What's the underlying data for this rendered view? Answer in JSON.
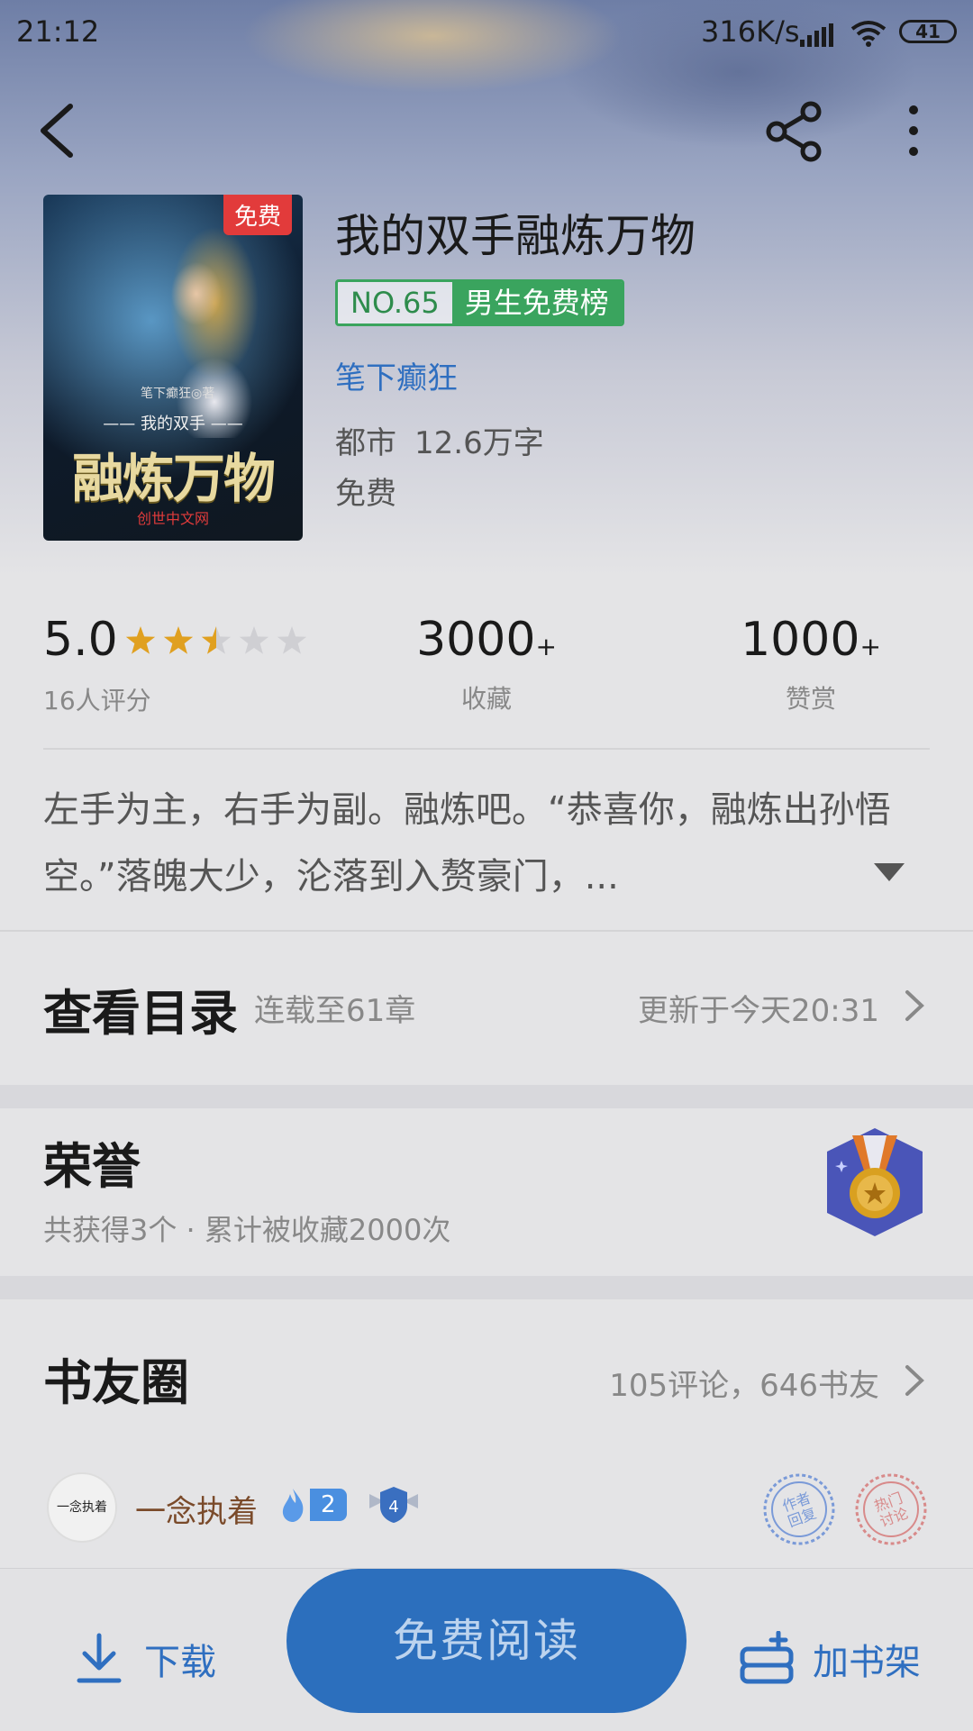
{
  "status_bar": {
    "time": "21:12",
    "net_speed": "316K/s",
    "battery": "41"
  },
  "nav": {
    "back_icon": "back-arrow-icon",
    "share_icon": "share-icon",
    "more_icon": "more-vert-icon"
  },
  "book": {
    "cover": {
      "badge": "免费",
      "author_line": "笔下癫狂◎著",
      "sub_title": "—— 我的双手 ——",
      "title_art": "融炼万物",
      "publisher": "创世中文网"
    },
    "title": "我的双手融炼万物",
    "rank_no": "NO.65",
    "rank_list": "男生免费榜",
    "author": "笔下癫狂",
    "genre": "都市",
    "word_count": "12.6万字",
    "price": "免费"
  },
  "stats": {
    "rating": "5.0",
    "rating_stars": 2.5,
    "rating_max": 5,
    "rating_count": "16人评分",
    "favorites": "3000",
    "favorites_label": "收藏",
    "rewards": "1000",
    "rewards_label": "赞赏",
    "plus": "+"
  },
  "intro": {
    "text": "左手为主，右手为副。融炼吧。“恭喜你，融炼出孙悟空。”落魄大少，沦落到入赘豪门，..."
  },
  "catalog": {
    "title": "查看目录",
    "status": "连载至61章",
    "update": "更新于今天20:31"
  },
  "honor": {
    "title": "荣誉",
    "desc": "共获得3个 · 累计被收藏2000次"
  },
  "circle": {
    "title": "书友圈",
    "meta": "105评论，646书友",
    "post": {
      "avatar_text": "一念执着",
      "user": "一念执着",
      "fire_level": "2",
      "badge_level": "4",
      "stamps": [
        "作者回复",
        "热门讨论"
      ]
    }
  },
  "bottom_bar": {
    "download": "下载",
    "read": "免费阅读",
    "shelf": "加书架"
  },
  "colors": {
    "accent_blue": "#2f6fc0",
    "button_blue": "#2c6fbd",
    "rank_green": "#3aa45e",
    "star_gold": "#e0a020",
    "badge_red": "#e23b3b"
  }
}
